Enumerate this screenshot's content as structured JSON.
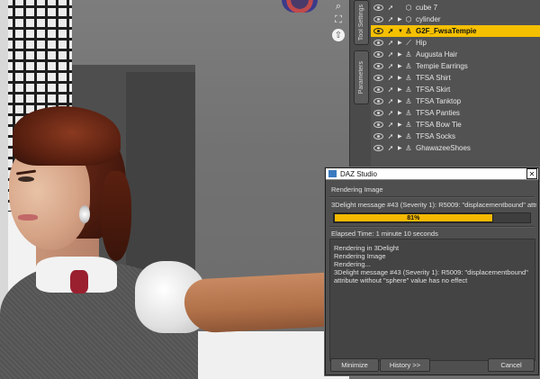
{
  "viewport": {
    "nav_icons": [
      "zoom-icon",
      "frame-icon",
      "orbit-icon"
    ]
  },
  "tool_tabs": [
    "Tool Settings",
    "Parameters"
  ],
  "scene_tree": {
    "rows": [
      {
        "label": "cube 7",
        "expander": "",
        "node_icon": "cube-icon",
        "selected": false
      },
      {
        "label": "cylinder",
        "expander": "▶",
        "node_icon": "cylinder-icon",
        "selected": false
      },
      {
        "label": "G2F_FwsaTempie",
        "expander": "▼",
        "node_icon": "figure-icon",
        "selected": true
      },
      {
        "label": "Hip",
        "expander": "▶",
        "node_icon": "bone-icon",
        "selected": false
      },
      {
        "label": "Augusta Hair",
        "expander": "▶",
        "node_icon": "figure-icon",
        "selected": false
      },
      {
        "label": "Tempie Earrings",
        "expander": "▶",
        "node_icon": "figure-icon",
        "selected": false
      },
      {
        "label": "TFSA Shirt",
        "expander": "▶",
        "node_icon": "figure-icon",
        "selected": false
      },
      {
        "label": "TFSA Skirt",
        "expander": "▶",
        "node_icon": "figure-icon",
        "selected": false
      },
      {
        "label": "TFSA Tanktop",
        "expander": "▶",
        "node_icon": "figure-icon",
        "selected": false
      },
      {
        "label": "TFSA Panties",
        "expander": "▶",
        "node_icon": "figure-icon",
        "selected": false
      },
      {
        "label": "TFSA Bow Tie",
        "expander": "▶",
        "node_icon": "figure-icon",
        "selected": false
      },
      {
        "label": "TFSA Socks",
        "expander": "▶",
        "node_icon": "figure-icon",
        "selected": false
      },
      {
        "label": "GhawazeeShoes",
        "expander": "▶",
        "node_icon": "figure-icon",
        "selected": false
      }
    ]
  },
  "render_dialog": {
    "title": "DAZ Studio",
    "status": "Rendering Image",
    "message": "3Delight message #43 (Severity 1): R5009: \"displacementbound\" attri",
    "progress": 0.81,
    "progress_label": "81%",
    "elapsed": "Elapsed Time:  1 minute 10 seconds",
    "log": [
      "Rendering in 3Delight",
      "Rendering Image",
      "Rendering...",
      "3Delight message #43 (Severity 1): R5009: \"displacementbound\"",
      "attribute without \"sphere\" value has no effect"
    ],
    "buttons": {
      "minimize": "Minimize",
      "history": "History >>",
      "cancel": "Cancel"
    }
  },
  "colors": {
    "selection": "#f5c000",
    "progress_fill": "#f5b900",
    "panel_bg": "#525252"
  }
}
